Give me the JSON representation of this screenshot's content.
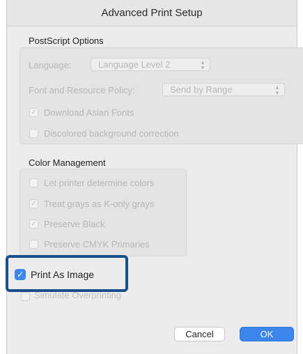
{
  "dialog": {
    "title": "Advanced Print Setup"
  },
  "postscript": {
    "heading": "PostScript Options",
    "language_label": "Language:",
    "language_value": "Language Level 2",
    "font_policy_label": "Font and Resource Policy:",
    "font_policy_value": "Send by Range",
    "download_asian_fonts": {
      "label": "Download Asian Fonts",
      "checked": true
    },
    "discolored_bg": {
      "label": "Discolored background correction",
      "checked": false
    }
  },
  "color_management": {
    "heading": "Color Management",
    "let_printer": {
      "label": "Let printer determine colors",
      "checked": false
    },
    "treat_grays": {
      "label": "Treat grays as K-only grays",
      "checked": true
    },
    "preserve_black": {
      "label": "Preserve Black",
      "checked": true
    },
    "preserve_cmyk": {
      "label": "Preserve CMYK Primaries",
      "checked": false
    }
  },
  "print_as_image": {
    "label": "Print As Image",
    "checked": true
  },
  "simulate_overprinting": {
    "label": "Simulate Overprinting",
    "checked": false
  },
  "buttons": {
    "cancel": "Cancel",
    "ok": "OK"
  },
  "colors": {
    "accent": "#3a86ea",
    "highlight_border": "#1a4f8e",
    "disabled_text": "#b7b7b7"
  }
}
